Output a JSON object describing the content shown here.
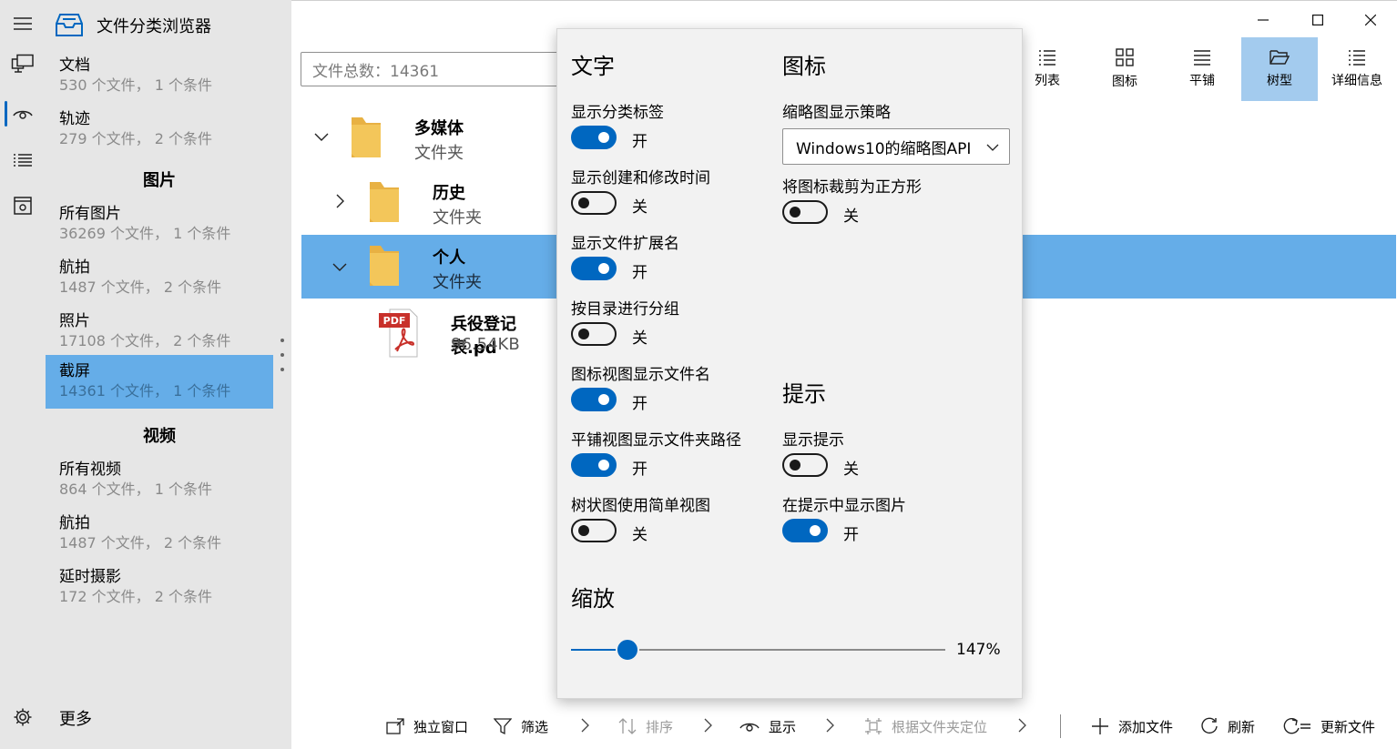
{
  "app": {
    "title": "文件分类浏览器"
  },
  "sidebar": {
    "items": [
      {
        "name": "文档",
        "sub": "530 个文件， 1 个条件"
      },
      {
        "name": "轨迹",
        "sub": "279 个文件， 2 个条件"
      },
      {
        "name": "所有图片",
        "sub": "36269 个文件， 1 个条件"
      },
      {
        "name": "航拍",
        "sub": "1487 个文件， 2 个条件"
      },
      {
        "name": "照片",
        "sub": "17108 个文件， 2 个条件"
      },
      {
        "name": "截屏",
        "sub": "14361 个文件， 1 个条件"
      },
      {
        "name": "所有视频",
        "sub": "864 个文件， 1 个条件"
      },
      {
        "name": "航拍",
        "sub": "1487 个文件， 2 个条件"
      },
      {
        "name": "延时摄影",
        "sub": "172 个文件， 2 个条件"
      }
    ],
    "headers": {
      "pictures": "图片",
      "videos": "视频"
    },
    "more": "更多"
  },
  "main": {
    "search_placeholder": "文件总数：14361",
    "view_buttons": [
      "列表",
      "图标",
      "平铺",
      "树型",
      "详细信息"
    ],
    "tree": {
      "multimedia": {
        "name": "多媒体",
        "type": "文件夹"
      },
      "history": {
        "name": "历史",
        "type": "文件夹"
      },
      "personal": {
        "name": "个人",
        "type": "文件夹"
      },
      "file": {
        "name": "兵役登记表.pd",
        "size": "96.54KB",
        "badge": "PDF"
      }
    },
    "toolbar": {
      "standalone": "独立窗口",
      "filter": "筛选",
      "sort": "排序",
      "display": "显示",
      "locate": "根据文件夹定位",
      "add": "添加文件",
      "refresh": "刷新",
      "update": "更新文件"
    }
  },
  "popup": {
    "text": {
      "title": "文字",
      "options": [
        {
          "label": "显示分类标签",
          "state": "开",
          "on": true
        },
        {
          "label": "显示创建和修改时间",
          "state": "关",
          "on": false
        },
        {
          "label": "显示文件扩展名",
          "state": "开",
          "on": true
        },
        {
          "label": "按目录进行分组",
          "state": "关",
          "on": false
        },
        {
          "label": "图标视图显示文件名",
          "state": "开",
          "on": true
        },
        {
          "label": "平铺视图显示文件夹路径",
          "state": "开",
          "on": true
        },
        {
          "label": "树状图使用简单视图",
          "state": "关",
          "on": false
        }
      ]
    },
    "icons": {
      "title": "图标",
      "thumb_label": "缩略图显示策略",
      "thumb_value": "Windows10的缩略图API",
      "crop_label": "将图标裁剪为正方形",
      "crop_state": "关",
      "crop_on": false
    },
    "tips": {
      "title": "提示",
      "options": [
        {
          "label": "显示提示",
          "state": "关",
          "on": false
        },
        {
          "label": "在提示中显示图片",
          "state": "开",
          "on": true
        }
      ]
    },
    "zoom": {
      "title": "缩放",
      "value": "147%",
      "percent": 147
    }
  },
  "colors": {
    "accent": "#0067c0",
    "selected_row": "#65ade8",
    "selected_view": "#a3cbee",
    "sidebar_bg": "#e6e6e6",
    "popup_bg": "#f2f2f2",
    "folder": "#f3c65a"
  }
}
